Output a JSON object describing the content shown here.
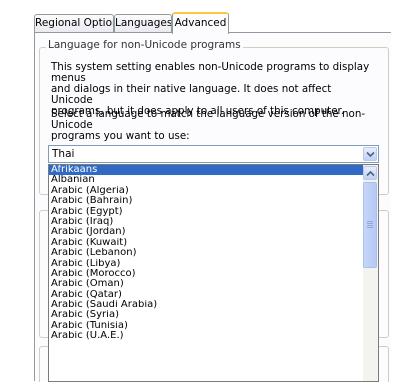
{
  "tabs": [
    {
      "label": "Regional Options",
      "selected": false
    },
    {
      "label": "Languages",
      "selected": false
    },
    {
      "label": "Advanced",
      "selected": true
    }
  ],
  "group": {
    "legend": "Language for non-Unicode programs",
    "description_lines": [
      "This system setting enables non-Unicode programs to display menus",
      "and dialogs in their native language. It does not affect Unicode",
      "programs, but it does apply to all users of this computer."
    ],
    "prompt_lines": [
      "Select a language to match the language version of the non-Unicode",
      "programs you want to use:"
    ]
  },
  "combo": {
    "value": "Thai"
  },
  "dropdown": {
    "selected_index": 0,
    "items": [
      "Afrikaans",
      "Albanian",
      "Arabic (Algeria)",
      "Arabic (Bahrain)",
      "Arabic (Egypt)",
      "Arabic (Iraq)",
      "Arabic (Jordan)",
      "Arabic (Kuwait)",
      "Arabic (Lebanon)",
      "Arabic (Libya)",
      "Arabic (Morocco)",
      "Arabic (Oman)",
      "Arabic (Qatar)",
      "Arabic (Saudi Arabia)",
      "Arabic (Syria)",
      "Arabic (Tunisia)",
      "Arabic (U.A.E.)"
    ]
  },
  "colors": {
    "selection": "#316ac5",
    "tab_accent": "#ffc83c"
  },
  "icons": {
    "combo_button": "chevron-down-icon",
    "scroll_up": "chevron-up-icon"
  }
}
